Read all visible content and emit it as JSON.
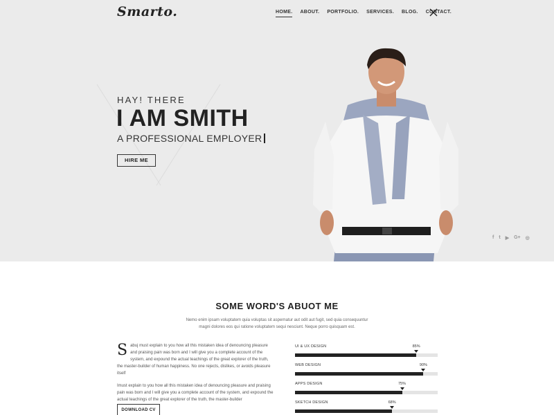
{
  "brand": {
    "logo": "Smarto."
  },
  "nav": {
    "items": [
      {
        "label": "HOME.",
        "active": true
      },
      {
        "label": "ABOUT.",
        "active": false
      },
      {
        "label": "PORTFOLIO.",
        "active": false
      },
      {
        "label": "SERVICES.",
        "active": false
      },
      {
        "label": "BLOG.",
        "active": false
      },
      {
        "label": "CONTACT.",
        "active": false
      }
    ],
    "close_icon": "close-icon"
  },
  "hero": {
    "greeting": "HAY! THERE",
    "name": "I AM SMITH",
    "subtitle": "A PROFESSIONAL EMPLOYER",
    "hire_label": "HIRE ME",
    "background_color": "#ebebeb"
  },
  "social": [
    {
      "icon": "facebook-icon",
      "glyph": "f"
    },
    {
      "icon": "twitter-icon",
      "glyph": "t"
    },
    {
      "icon": "youtube-icon",
      "glyph": "▶"
    },
    {
      "icon": "google-plus-icon",
      "glyph": "G+"
    },
    {
      "icon": "instagram-icon",
      "glyph": "◎"
    }
  ],
  "about": {
    "title": "SOME WORD'S ABUOT ME",
    "intro": "Nemo enim ipsam voluptatem quia voluptas sit aspernatur aut odit aut fugit, sed quia consequuntur magni dolores eos qui ratione voluptatem sequi nesciunt. Neque porro quisquam est.",
    "bio_drop": "S",
    "bio_p1": "abuj must explain to you how all this mistaken idea of denouncing pleasure and praising pain was born and I will give you a complete account of the system, and expound the actual teachings of the great explorer of the truth, the master-builder of human happiness. No one rejects, dislikes, or avoids pleasure itself",
    "bio_p2": "Imust explain to you how all this mistaken idea of denouncing pleasure and praising pain was born and I will give you a complete account of the system, and expound the actual teachings of the great explorer of the truth, the master-builder",
    "download_label": "DOWNLOAD CV"
  },
  "skills": [
    {
      "label": "UI & UX DESIGN",
      "percent_label": "85%",
      "value": 85
    },
    {
      "label": "WEB DESIGN",
      "percent_label": "90%",
      "value": 90
    },
    {
      "label": "APPS DESIGN",
      "percent_label": "75%",
      "value": 75
    },
    {
      "label": "SKETCH DESIGN",
      "percent_label": "68%",
      "value": 68
    }
  ]
}
